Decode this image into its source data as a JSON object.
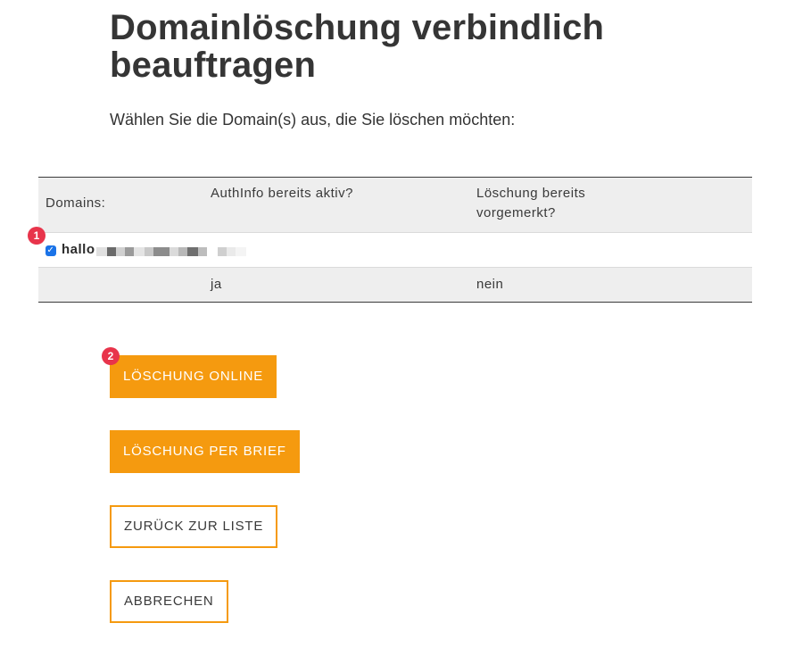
{
  "header": {
    "title": "Domainlöschung verbindlich beauftragen",
    "intro": "Wählen Sie die Domain(s) aus, die Sie löschen möchten:"
  },
  "table": {
    "columns": [
      "Domains:",
      "AuthInfo bereits aktiv?",
      "Löschung bereits vorgemerkt?"
    ],
    "rows": [
      {
        "domain": "hallo",
        "checked": true,
        "authinfo_active": "ja",
        "deletion_scheduled": "nein"
      }
    ]
  },
  "annotations": {
    "badge_1": "1",
    "badge_2": "2"
  },
  "buttons": {
    "delete_online": "LÖSCHUNG ONLINE",
    "delete_by_letter": "LÖSCHUNG PER BRIEF",
    "back_to_list": "ZURÜCK ZUR LISTE",
    "cancel": "ABBRECHEN"
  },
  "checkbox_icon": "checkmark-icon",
  "colors": {
    "accent": "#f59a0f",
    "badge": "#e8344b",
    "checkbox": "#1a73e8",
    "table_header_bg": "#eeeeee"
  }
}
